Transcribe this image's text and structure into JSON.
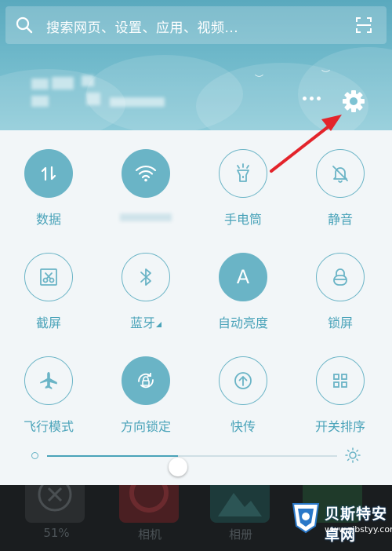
{
  "search": {
    "placeholder": "搜索网页、设置、应用、视频..."
  },
  "tiles": [
    {
      "label": "数据",
      "on": true,
      "icon": "data-transfer-icon"
    },
    {
      "label": "",
      "on": true,
      "icon": "wifi-icon"
    },
    {
      "label": "手电筒",
      "on": false,
      "icon": "flashlight-icon"
    },
    {
      "label": "静音",
      "on": false,
      "icon": "mute-bell-icon"
    },
    {
      "label": "截屏",
      "on": false,
      "icon": "screenshot-icon"
    },
    {
      "label": "蓝牙",
      "on": false,
      "icon": "bluetooth-icon"
    },
    {
      "label": "自动亮度",
      "on": true,
      "icon": "auto-brightness-icon"
    },
    {
      "label": "锁屏",
      "on": false,
      "icon": "lock-icon"
    },
    {
      "label": "飞行模式",
      "on": false,
      "icon": "airplane-icon"
    },
    {
      "label": "方向锁定",
      "on": true,
      "icon": "rotation-lock-icon"
    },
    {
      "label": "快传",
      "on": false,
      "icon": "quick-transfer-icon"
    },
    {
      "label": "开关排序",
      "on": false,
      "icon": "grid-sort-icon"
    }
  ],
  "auto_brightness_letter": "A",
  "brightness": {
    "level": 0.45
  },
  "dock": {
    "labels": [
      "51%",
      "相机",
      "相册"
    ]
  },
  "watermark": {
    "title": "贝斯特安卓网",
    "url": "www.zjbstyy.com"
  },
  "colors": {
    "accent": "#6ab4c6",
    "label": "#4aa3b9",
    "arrow": "#e3242b"
  }
}
